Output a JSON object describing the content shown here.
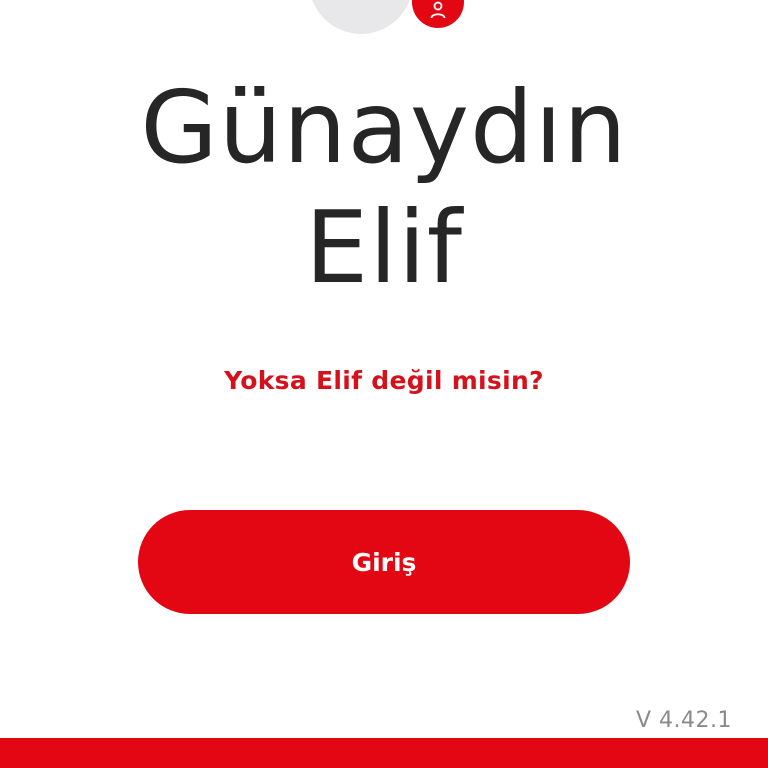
{
  "greeting": {
    "line1": "Günaydın",
    "line2": "Elif"
  },
  "not_you_link": "Yoksa Elif değil misin?",
  "login_button_label": "Giriş",
  "version": "V 4.42.1",
  "colors": {
    "brand_red": "#e30613",
    "link_red": "#d5121c",
    "text_dark": "#262626",
    "avatar_bg": "#e8e8eb",
    "version_gray": "#8a8a8a"
  },
  "icons": {
    "avatar_badge": "user-icon"
  }
}
